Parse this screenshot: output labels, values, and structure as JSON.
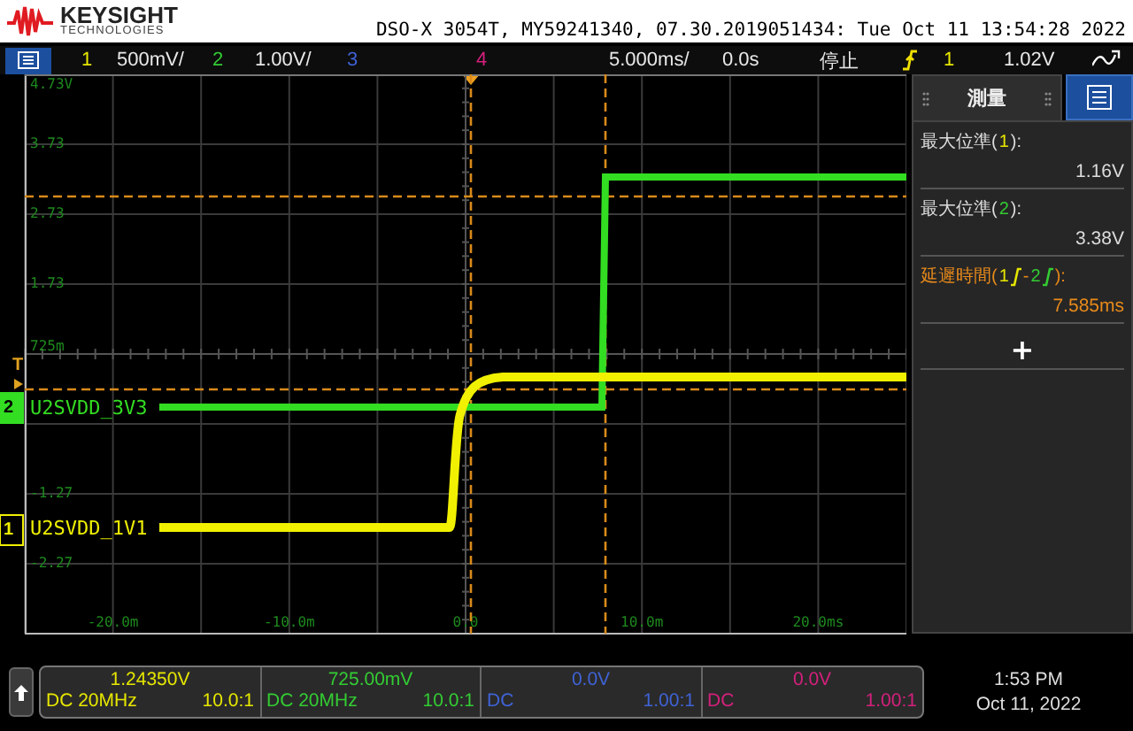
{
  "header": {
    "brand": "KEYSIGHT",
    "tagline": "TECHNOLOGIES",
    "title": "DSO-X 3054T, MY59241340, 07.30.2019051434: Tue Oct 11 13:54:28 2022"
  },
  "channels": [
    {
      "num": "1",
      "color": "#e6e600",
      "scale": "500mV/",
      "offset": "1.24350V",
      "coupling": "DC 20MHz",
      "probe": "10.0:1"
    },
    {
      "num": "2",
      "color": "#33cc33",
      "scale": "1.00V/",
      "offset": "725.00mV",
      "coupling": "DC 20MHz",
      "probe": "10.0:1"
    },
    {
      "num": "3",
      "color": "#3f63d6",
      "offset": "0.0V",
      "coupling": "DC",
      "probe": "1.00:1"
    },
    {
      "num": "4",
      "color": "#d4207c",
      "offset": "0.0V",
      "coupling": "DC",
      "probe": "1.00:1"
    }
  ],
  "timebase": {
    "scale": "5.000ms/",
    "delay": "0.0s"
  },
  "run_state": "停止",
  "trigger": {
    "source": "1",
    "level": "1.02V"
  },
  "plot": {
    "y_labels": [
      "4.73V",
      "3.73",
      "2.73",
      "1.73",
      "725m",
      "-1.27",
      "-2.27"
    ],
    "x_labels": [
      "-20.0m",
      "-10.0m",
      "0.0",
      "10.0m",
      "20.0ms"
    ],
    "trigger_marker": "T",
    "traces": [
      {
        "num": "2",
        "label": "U2SVDD_3V3",
        "color": "#33dd22"
      },
      {
        "num": "1",
        "label": "U2SVDD_1V1",
        "color": "#f0f000"
      }
    ]
  },
  "measurements": {
    "title": "測量",
    "items": [
      {
        "segments": [
          {
            "text": "最大位準(",
            "edge": false
          },
          {
            "text": "1",
            "color": "#e6e600",
            "edge": false
          },
          {
            "text": "):",
            "edge": false
          }
        ],
        "value": "1.16V",
        "selected": false
      },
      {
        "segments": [
          {
            "text": "最大位準(",
            "edge": false
          },
          {
            "text": "2",
            "color": "#33cc33",
            "edge": false
          },
          {
            "text": "):",
            "edge": false
          }
        ],
        "value": "3.38V",
        "selected": false
      },
      {
        "segments": [
          {
            "text": "延遲時間(",
            "edge": false
          },
          {
            "text": "1",
            "color": "#e6e600",
            "edge": true
          },
          {
            "text": "-",
            "edge": false
          },
          {
            "text": "2",
            "color": "#33cc33",
            "edge": true
          },
          {
            "text": "):",
            "edge": false
          }
        ],
        "value": "7.585ms",
        "selected": true
      }
    ],
    "add_symbol": "+"
  },
  "clock": {
    "time": "1:53 PM",
    "date": "Oct 11, 2022"
  }
}
